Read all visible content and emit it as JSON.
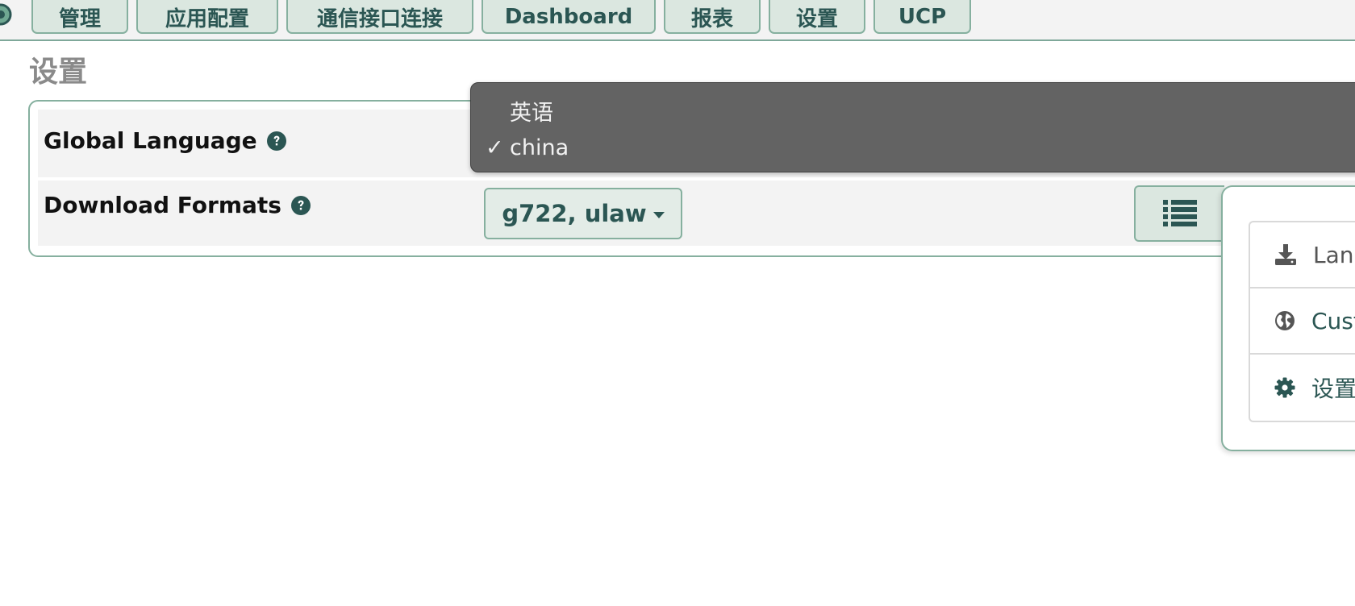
{
  "nav": {
    "tabs": [
      {
        "label": "管理"
      },
      {
        "label": "应用配置"
      },
      {
        "label": "通信接口连接"
      },
      {
        "label": "Dashboard"
      },
      {
        "label": "报表"
      },
      {
        "label": "设置"
      },
      {
        "label": "UCP"
      }
    ]
  },
  "page": {
    "title": "设置"
  },
  "settings": {
    "rows": [
      {
        "label": "Global Language",
        "help_icon": "question-circle-icon"
      },
      {
        "label": "Download Formats",
        "help_icon": "question-circle-icon"
      }
    ],
    "download_formats": {
      "value": "g722, ulaw",
      "icon": "caret-down-icon"
    }
  },
  "language_dropdown": {
    "options": [
      {
        "label": "英语",
        "selected": false
      },
      {
        "label": "china",
        "selected": true
      }
    ],
    "check_mark": "✓"
  },
  "side_menu": {
    "toggle_icon": "list-icon",
    "items": [
      {
        "label": "Lang",
        "icon": "download-icon"
      },
      {
        "label": "Cust",
        "icon": "globe-icon"
      },
      {
        "label": "设置",
        "icon": "gear-icon"
      }
    ]
  },
  "colors": {
    "accent": "#2b5653",
    "border": "#86b09f",
    "tab_bg": "#dbe7e0",
    "dropdown_bg": "#636363"
  }
}
